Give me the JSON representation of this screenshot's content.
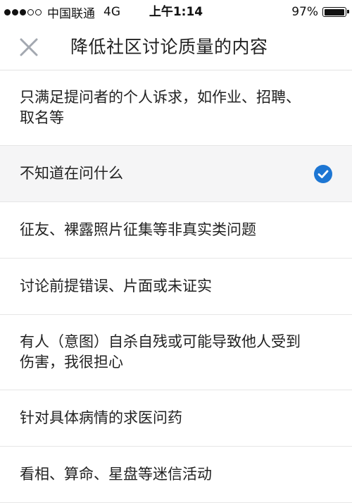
{
  "status_bar": {
    "signal_filled": 3,
    "signal_total": 5,
    "carrier": "中国联通",
    "network": "4G",
    "time": "上午1:14",
    "battery_text": "97%",
    "battery_level": 0.97
  },
  "nav": {
    "close_icon": "close-x-icon",
    "title": "降低社区讨论质量的内容"
  },
  "options": [
    {
      "label": "只满足提问者的个人诉求，如作业、招聘、取名等",
      "selected": false
    },
    {
      "label": "不知道在问什么",
      "selected": true
    },
    {
      "label": "征友、裸露照片征集等非真实类问题",
      "selected": false
    },
    {
      "label": "讨论前提错误、片面或未证实",
      "selected": false
    },
    {
      "label": "有人（意图）自杀自残或可能导致他人受到伤害，我很担心",
      "selected": false
    },
    {
      "label": "针对具体病情的求医问药",
      "selected": false
    },
    {
      "label": "看相、算命、星盘等迷信活动",
      "selected": false
    }
  ],
  "colors": {
    "accent": "#1d76d3",
    "selected_bg": "#f5f5f6",
    "divider": "#e6e6e6",
    "close_icon": "#a3a8b0"
  }
}
